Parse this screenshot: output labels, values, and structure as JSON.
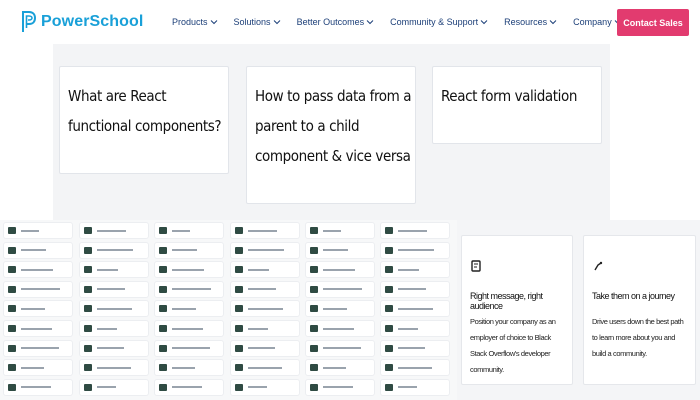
{
  "nav": {
    "brand": "PowerSchool",
    "menu": [
      {
        "label": "Products"
      },
      {
        "label": "Solutions"
      },
      {
        "label": "Better Outcomes"
      },
      {
        "label": "Community & Support"
      },
      {
        "label": "Resources"
      },
      {
        "label": "Company"
      }
    ],
    "cta": "Contact Sales"
  },
  "articles": [
    {
      "title": "What are React functional components?"
    },
    {
      "title": "How to pass data from a parent to a child component & vice versa"
    },
    {
      "title": "React form validation"
    }
  ],
  "cards": [
    {
      "title": "Right message, right audience",
      "body": "Position your company as an employer of choice to Black Stack Overflow's developer community."
    },
    {
      "title": "Take them on a journey",
      "body": "Drive users down the best path to learn more about you and build a community."
    }
  ],
  "colors": {
    "brand": "#19a0d8",
    "nav_text": "#1c3f78",
    "cta": "#e23b6f"
  }
}
